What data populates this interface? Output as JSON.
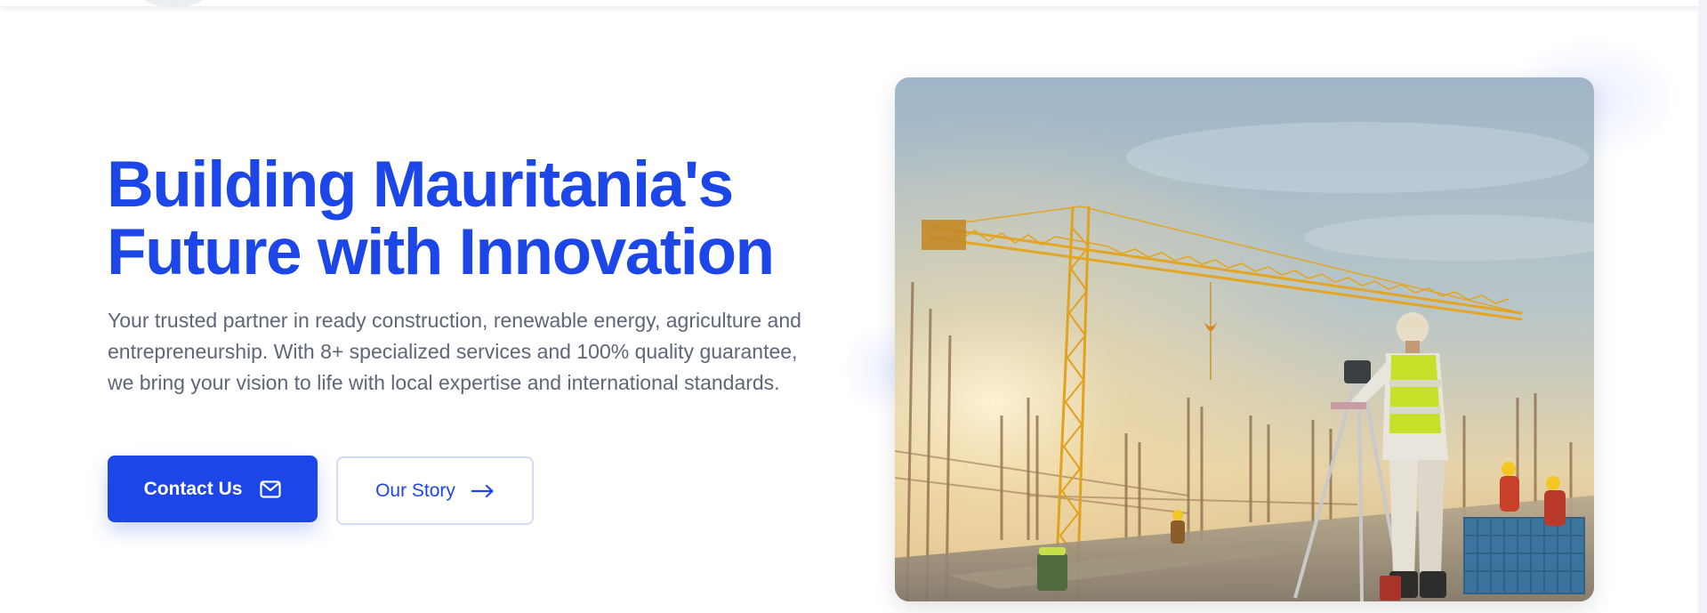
{
  "hero": {
    "title_line1": "Building Mauritania's",
    "title_line2": "Future with Innovation",
    "description": "Your trusted partner in ready construction, renewable energy, agriculture and entrepreneurship. With 8+ specialized services and 100% quality guarantee, we bring your vision to life with local expertise and international standards.",
    "image_alt": "Surveyor on a construction site with a tower crane"
  },
  "buttons": {
    "primary_label": "Contact Us",
    "primary_icon": "mail-icon",
    "secondary_label": "Our Story",
    "secondary_icon": "arrow-right-icon"
  },
  "colors": {
    "accent": "#1d46e8",
    "body_text": "#5d6778",
    "secondary_border": "#d3dcf4",
    "background": "#ffffff"
  }
}
